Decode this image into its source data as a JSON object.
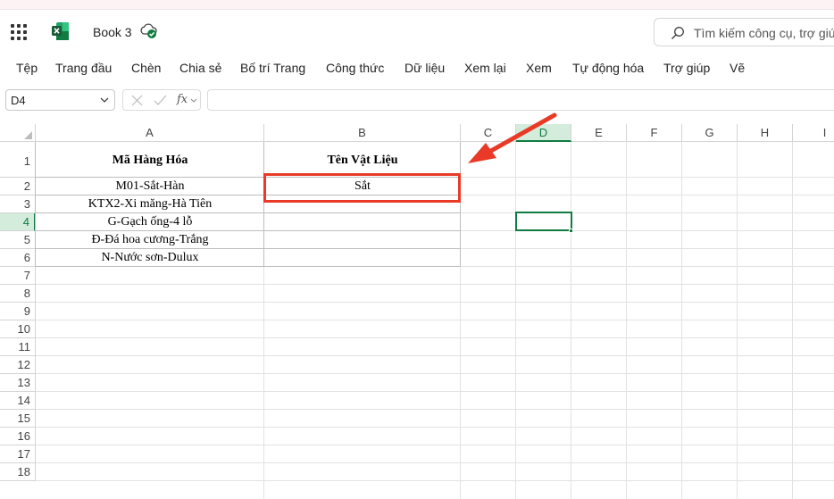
{
  "app": {
    "workbook_title": "Book 3",
    "search_placeholder": "Tìm kiếm công cụ, trợ giú"
  },
  "icons": {
    "launcher": "waffle-icon",
    "app": "excel-icon",
    "sync": "cloud-synced-icon",
    "search": "search-icon",
    "cancel": "close-icon",
    "enter": "checkmark-icon",
    "function": "fx-icon",
    "dropdown": "chevron-down-icon"
  },
  "menu": {
    "items": [
      "Tệp",
      "Trang đầu",
      "Chèn",
      "Chia sẻ",
      "Bố trí Trang",
      "Công thức",
      "Dữ liệu",
      "Xem lại",
      "Xem",
      "Tự động hóa",
      "Trợ giúp",
      "Vẽ"
    ]
  },
  "formula_bar": {
    "name_box": "D4",
    "fx_label": "fx",
    "value": ""
  },
  "sheet": {
    "columns": [
      "A",
      "B",
      "C",
      "D",
      "E",
      "F",
      "G",
      "H",
      "I"
    ],
    "selected_column": "D",
    "rows": [
      "1",
      "2",
      "3",
      "4",
      "5",
      "6",
      "7",
      "8",
      "9",
      "10",
      "11",
      "12",
      "13",
      "14",
      "15",
      "16",
      "17",
      "18"
    ],
    "selected_row": "4",
    "active_cell": "D4",
    "header_a": "Mã Hàng Hóa",
    "header_b": "Tên Vật Liệu",
    "column_a_values": [
      "M01-Sắt-Hàn",
      "KTX2-Xi măng-Hà Tiên",
      "G-Gạch ống-4 lỗ",
      "Đ-Đá hoa cương-Trắng",
      "N-Nước sơn-Dulux"
    ],
    "b2": "Sắt"
  },
  "annotation": {
    "highlight_color": "#e83a26",
    "highlight_target": "B2",
    "arrow_color": "#e83a26"
  },
  "colors": {
    "accent": "#107c41"
  }
}
